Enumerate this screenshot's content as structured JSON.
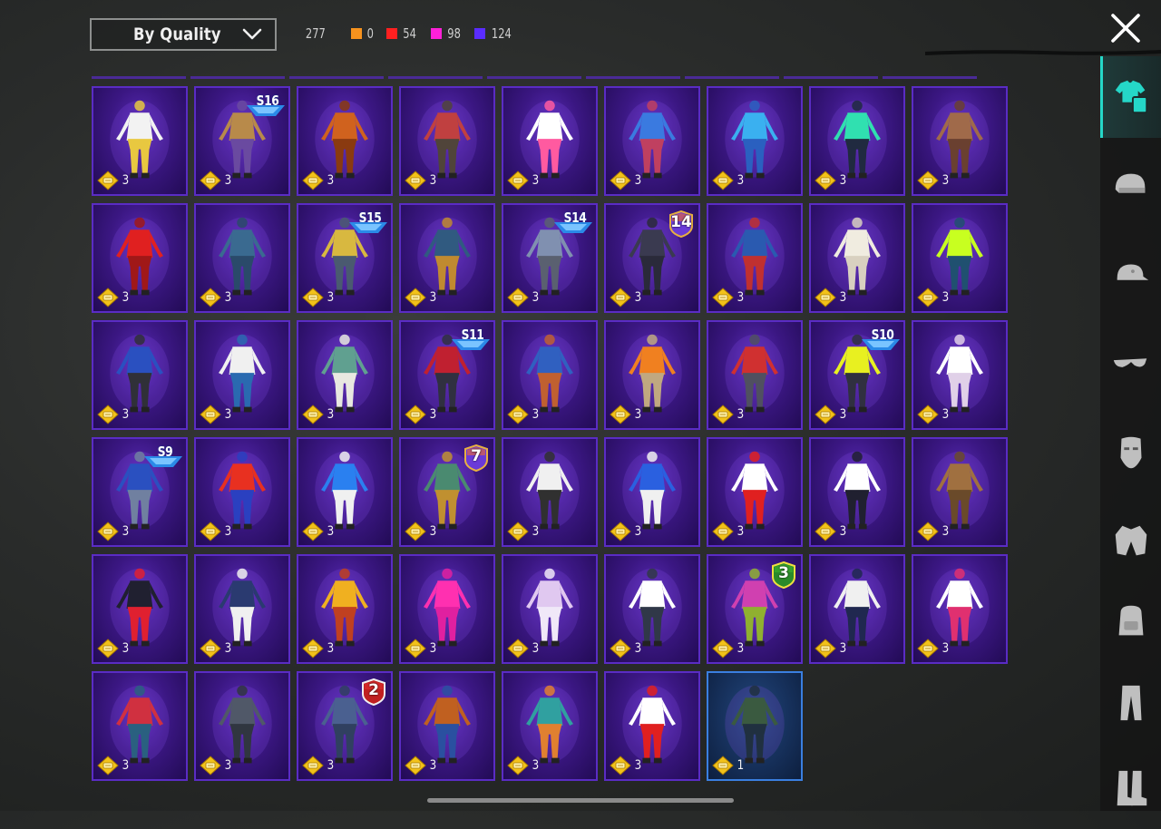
{
  "sort": {
    "label": "By Quality"
  },
  "counts": {
    "total": "277",
    "items": [
      {
        "color": "#f7931e",
        "value": "0"
      },
      {
        "color": "#ff2020",
        "value": "54"
      },
      {
        "color": "#ff20d8",
        "value": "98"
      },
      {
        "color": "#5a2cff",
        "value": "124"
      }
    ]
  },
  "tiles": [
    {
      "qty": "3",
      "badge": "",
      "badge_type": "",
      "c1": "#f2f2f2",
      "c2": "#e8c840"
    },
    {
      "qty": "3",
      "badge": "S16",
      "badge_type": "season",
      "c1": "#b88a4a",
      "c2": "#6a4aa0"
    },
    {
      "qty": "3",
      "badge": "",
      "badge_type": "",
      "c1": "#d0621e",
      "c2": "#8a3a10"
    },
    {
      "qty": "3",
      "badge": "",
      "badge_type": "",
      "c1": "#c04040",
      "c2": "#50443a"
    },
    {
      "qty": "3",
      "badge": "",
      "badge_type": "",
      "c1": "#ffffff",
      "c2": "#ff5aa0"
    },
    {
      "qty": "3",
      "badge": "",
      "badge_type": "",
      "c1": "#3a7ae0",
      "c2": "#c04060"
    },
    {
      "qty": "3",
      "badge": "",
      "badge_type": "",
      "c1": "#3ab0f0",
      "c2": "#2a60c0"
    },
    {
      "qty": "3",
      "badge": "",
      "badge_type": "",
      "c1": "#30e0b0",
      "c2": "#202a40"
    },
    {
      "qty": "3",
      "badge": "",
      "badge_type": "",
      "c1": "#a06a4a",
      "c2": "#6a4030"
    },
    {
      "qty": "3",
      "badge": "",
      "badge_type": "",
      "c1": "#e02020",
      "c2": "#a01818"
    },
    {
      "qty": "3",
      "badge": "",
      "badge_type": "",
      "c1": "#3a6a90",
      "c2": "#2a4a6a"
    },
    {
      "qty": "3",
      "badge": "S15",
      "badge_type": "season",
      "c1": "#d8b840",
      "c2": "#4a5a70"
    },
    {
      "qty": "3",
      "badge": "",
      "badge_type": "",
      "c1": "#305a80",
      "c2": "#c08a30"
    },
    {
      "qty": "3",
      "badge": "S14",
      "badge_type": "season",
      "c1": "#8090b0",
      "c2": "#5a6070"
    },
    {
      "qty": "3",
      "badge": "14",
      "badge_type": "number",
      "c1": "#3a3a50",
      "c2": "#2a2a3a"
    },
    {
      "qty": "3",
      "badge": "",
      "badge_type": "",
      "c1": "#2a5ab0",
      "c2": "#c03030"
    },
    {
      "qty": "3",
      "badge": "",
      "badge_type": "",
      "c1": "#f0ece0",
      "c2": "#d8d0c0"
    },
    {
      "qty": "3",
      "badge": "",
      "badge_type": "",
      "c1": "#c8ff20",
      "c2": "#205070"
    },
    {
      "qty": "3",
      "badge": "",
      "badge_type": "",
      "c1": "#2a50c0",
      "c2": "#303038"
    },
    {
      "qty": "3",
      "badge": "",
      "badge_type": "",
      "c1": "#f0f0f0",
      "c2": "#2a6ab0"
    },
    {
      "qty": "3",
      "badge": "",
      "badge_type": "",
      "c1": "#60a090",
      "c2": "#e8e8e0"
    },
    {
      "qty": "3",
      "badge": "S11",
      "badge_type": "season",
      "c1": "#c02030",
      "c2": "#303040"
    },
    {
      "qty": "3",
      "badge": "",
      "badge_type": "",
      "c1": "#3060c0",
      "c2": "#c06030"
    },
    {
      "qty": "3",
      "badge": "",
      "badge_type": "",
      "c1": "#f08020",
      "c2": "#c0a880"
    },
    {
      "qty": "3",
      "badge": "",
      "badge_type": "",
      "c1": "#d03030",
      "c2": "#505060"
    },
    {
      "qty": "3",
      "badge": "S10",
      "badge_type": "season",
      "c1": "#e8f020",
      "c2": "#303040"
    },
    {
      "qty": "3",
      "badge": "",
      "badge_type": "",
      "c1": "#ffffff",
      "c2": "#e0d0e8"
    },
    {
      "qty": "3",
      "badge": "S9",
      "badge_type": "season",
      "c1": "#2a50c0",
      "c2": "#7080a0"
    },
    {
      "qty": "3",
      "badge": "",
      "badge_type": "",
      "c1": "#e83020",
      "c2": "#2a40c0"
    },
    {
      "qty": "3",
      "badge": "",
      "badge_type": "",
      "c1": "#2a80f0",
      "c2": "#f0f0f0"
    },
    {
      "qty": "3",
      "badge": "7",
      "badge_type": "number",
      "c1": "#4a8a70",
      "c2": "#c09030"
    },
    {
      "qty": "3",
      "badge": "",
      "badge_type": "",
      "c1": "#f0f0f0",
      "c2": "#303030"
    },
    {
      "qty": "3",
      "badge": "",
      "badge_type": "",
      "c1": "#2a60e0",
      "c2": "#f0f0f0"
    },
    {
      "qty": "3",
      "badge": "",
      "badge_type": "",
      "c1": "#ffffff",
      "c2": "#e02020"
    },
    {
      "qty": "3",
      "badge": "",
      "badge_type": "",
      "c1": "#ffffff",
      "c2": "#202030"
    },
    {
      "qty": "3",
      "badge": "",
      "badge_type": "",
      "c1": "#a07040",
      "c2": "#6a4a2a"
    },
    {
      "qty": "3",
      "badge": "",
      "badge_type": "",
      "c1": "#202030",
      "c2": "#e02030"
    },
    {
      "qty": "3",
      "badge": "",
      "badge_type": "",
      "c1": "#2a3a70",
      "c2": "#f0f0f0"
    },
    {
      "qty": "3",
      "badge": "",
      "badge_type": "",
      "c1": "#f0b020",
      "c2": "#c04020"
    },
    {
      "qty": "3",
      "badge": "",
      "badge_type": "",
      "c1": "#ff30b0",
      "c2": "#e020a0"
    },
    {
      "qty": "3",
      "badge": "",
      "badge_type": "",
      "c1": "#e0c8f0",
      "c2": "#f0e8f8"
    },
    {
      "qty": "3",
      "badge": "",
      "badge_type": "",
      "c1": "#ffffff",
      "c2": "#303848"
    },
    {
      "qty": "3",
      "badge": "3",
      "badge_type": "number-green",
      "c1": "#d040b0",
      "c2": "#90b030"
    },
    {
      "qty": "3",
      "badge": "",
      "badge_type": "",
      "c1": "#f0f0f0",
      "c2": "#202850"
    },
    {
      "qty": "3",
      "badge": "",
      "badge_type": "",
      "c1": "#ffffff",
      "c2": "#e03070"
    },
    {
      "qty": "3",
      "badge": "",
      "badge_type": "",
      "c1": "#d03040",
      "c2": "#2a6080"
    },
    {
      "qty": "3",
      "badge": "",
      "badge_type": "",
      "c1": "#505868",
      "c2": "#303640"
    },
    {
      "qty": "3",
      "badge": "2",
      "badge_type": "number-red",
      "c1": "#4a6090",
      "c2": "#304060"
    },
    {
      "qty": "3",
      "badge": "",
      "badge_type": "",
      "c1": "#c06020",
      "c2": "#2a50a0"
    },
    {
      "qty": "3",
      "badge": "",
      "badge_type": "",
      "c1": "#30a0a0",
      "c2": "#e08030"
    },
    {
      "qty": "3",
      "badge": "",
      "badge_type": "",
      "c1": "#ffffff",
      "c2": "#e02020"
    },
    {
      "qty": "1",
      "badge": "",
      "badge_type": "",
      "c1": "#3a5a40",
      "c2": "#203040",
      "selected": true
    }
  ],
  "sidebar": {
    "active_color": "#25d7c8",
    "items": [
      {
        "icon": "outfit-icon",
        "active": true
      },
      {
        "icon": "helmet-icon",
        "active": false
      },
      {
        "icon": "cap-icon",
        "active": false
      },
      {
        "icon": "glasses-icon",
        "active": false
      },
      {
        "icon": "mask-icon",
        "active": false
      },
      {
        "icon": "jacket-icon",
        "active": false
      },
      {
        "icon": "backpack-icon",
        "active": false
      },
      {
        "icon": "pants-icon",
        "active": false
      },
      {
        "icon": "boots-icon",
        "active": false
      }
    ]
  }
}
